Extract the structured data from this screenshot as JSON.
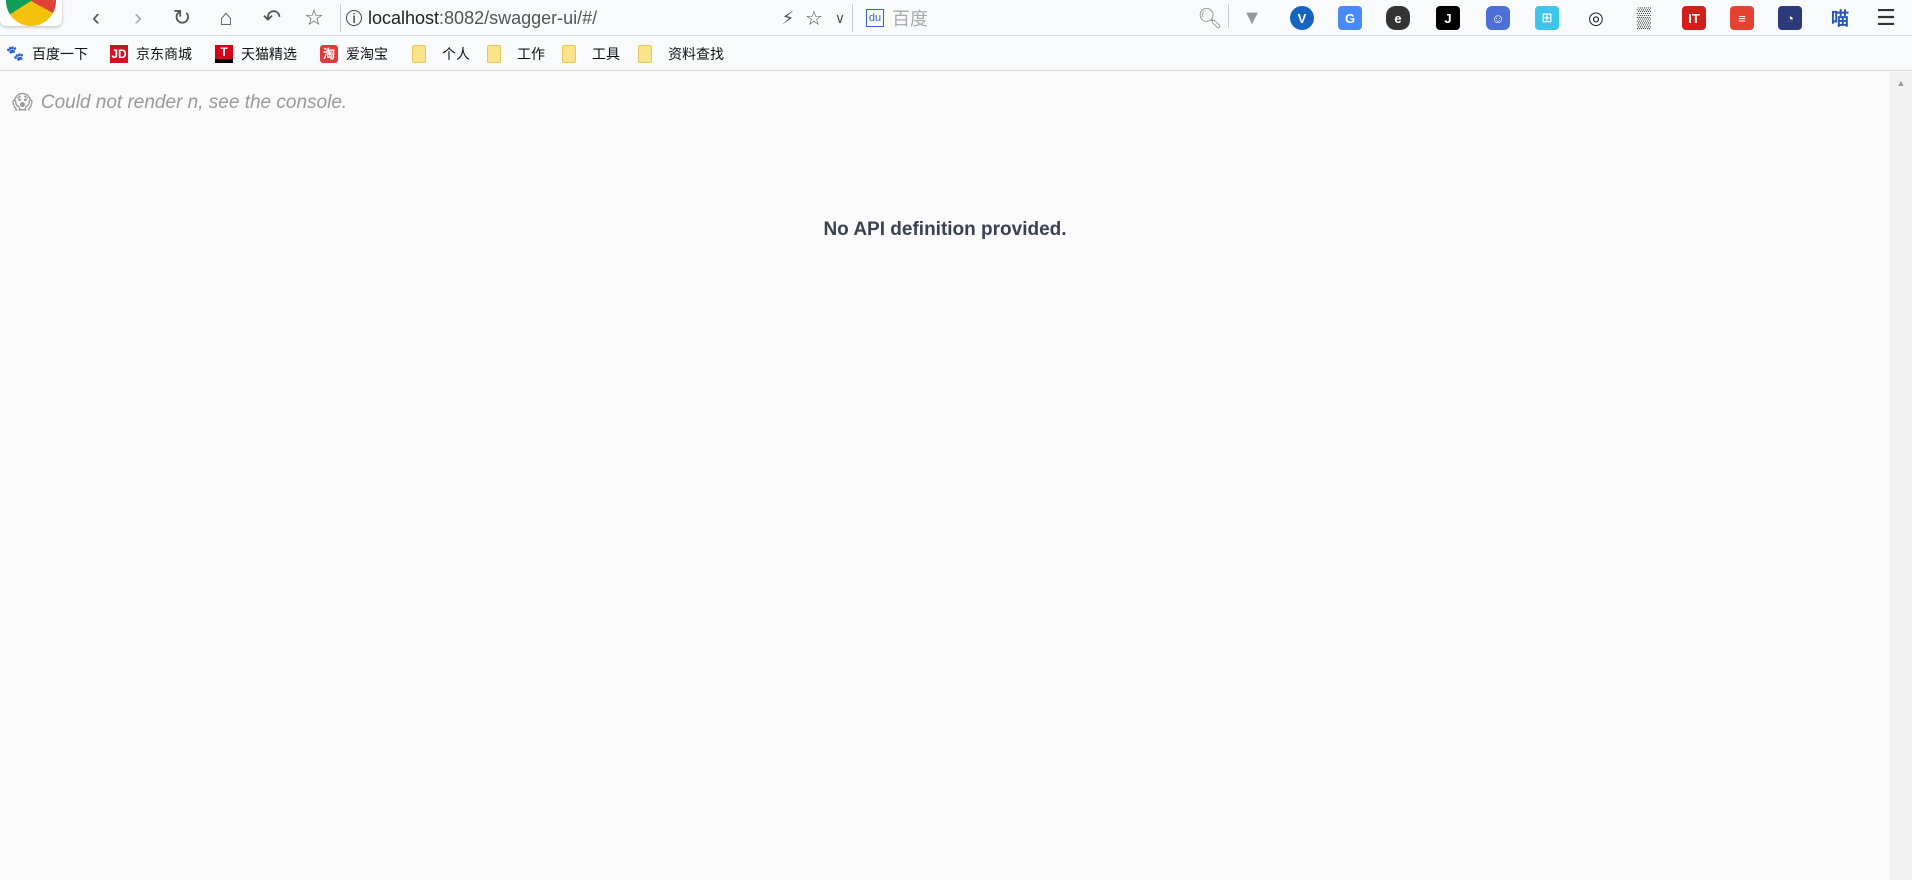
{
  "toolbar": {
    "url_host": "localhost",
    "url_rest": ":8082/swagger-ui/#/",
    "search_placeholder": "百度"
  },
  "bookmarks": [
    {
      "label": "百度一下",
      "icon": "baidu-icon"
    },
    {
      "label": "京东商城",
      "icon": "jd-icon",
      "icon_text": "JD",
      "color": "#c81623"
    },
    {
      "label": "天猫精选",
      "icon": "tmall-icon",
      "icon_text": "T",
      "color": "#d4001a"
    },
    {
      "label": "爱淘宝",
      "icon": "taobao-icon",
      "icon_text": "淘",
      "color": "#e4393c"
    },
    {
      "label": "个人",
      "icon": "folder-icon"
    },
    {
      "label": "工作",
      "icon": "folder-icon"
    },
    {
      "label": "工具",
      "icon": "folder-icon"
    },
    {
      "label": "资料查找",
      "icon": "folder-icon"
    }
  ],
  "main": {
    "error_message": "Could not render n, see the console.",
    "no_api": "No API definition provided."
  }
}
